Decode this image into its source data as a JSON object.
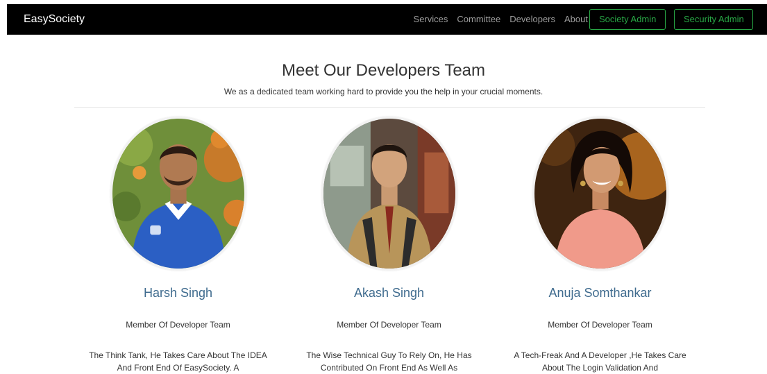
{
  "navbar": {
    "brand": "EasySociety",
    "links": [
      "Services",
      "Committee",
      "Developers",
      "About"
    ],
    "society_admin_label": "Society Admin",
    "security_admin_label": "Security Admin"
  },
  "hero": {
    "title": "Meet Our Developers Team",
    "subtitle": "We as a dedicated team working hard to provide you the help in your crucial moments."
  },
  "team": [
    {
      "name": "Harsh Singh",
      "role": "Member Of Developer Team",
      "description": "The Think Tank, He Takes Care About The IDEA And Front End Of EasySociety. A"
    },
    {
      "name": "Akash Singh",
      "role": "Member Of Developer Team",
      "description": "The Wise Technical Guy To Rely On, He Has Contributed On Front End As Well As"
    },
    {
      "name": "Anuja Somthankar",
      "role": "Member Of Developer Team",
      "description": "A Tech-Freak And A Developer ,He Takes Care About The Login Validation And"
    }
  ],
  "colors": {
    "navbar_bg": "#000000",
    "nav_link": "#9d9d9d",
    "accent_green": "#28a745",
    "name_blue": "#3f6b8e",
    "text": "#333333"
  }
}
